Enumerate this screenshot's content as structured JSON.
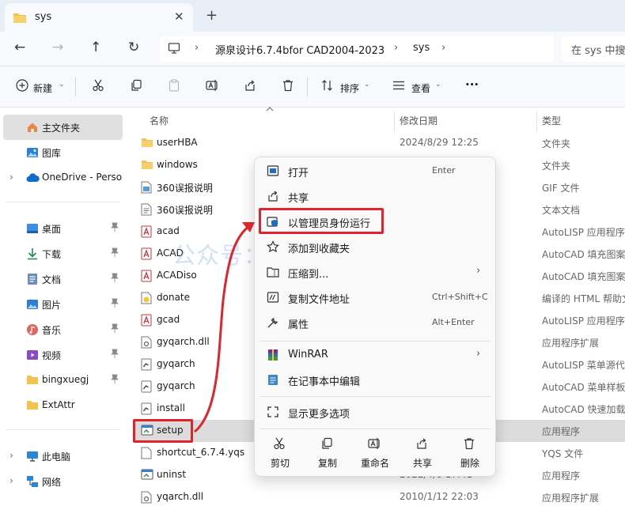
{
  "tab": {
    "title": "sys",
    "close": "✕",
    "new_tab": "+"
  },
  "nav": {
    "back": "←",
    "forward": "→",
    "up": "↑",
    "refresh": "↻"
  },
  "address": {
    "sep": "›",
    "crumbs": [
      "源泉设计6.7.4bfor CAD2004-2023",
      "sys"
    ],
    "search_placeholder": "在 sys 中搜"
  },
  "toolbar": {
    "new_label": "新建",
    "sort_label": "排序",
    "view_label": "查看",
    "more": "···",
    "caret": "⌄"
  },
  "sidebar": {
    "chevron": "›",
    "pin": "📌",
    "top": [
      {
        "label": "主文件夹",
        "icon": "home-icon"
      },
      {
        "label": "图库",
        "icon": "gallery-icon"
      },
      {
        "label": "OneDrive - Perso",
        "icon": "cloud-icon"
      }
    ],
    "quick": [
      {
        "label": "桌面",
        "icon": "desktop-icon"
      },
      {
        "label": "下载",
        "icon": "download-icon"
      },
      {
        "label": "文档",
        "icon": "documents-icon"
      },
      {
        "label": "图片",
        "icon": "pictures-icon"
      },
      {
        "label": "音乐",
        "icon": "music-icon"
      },
      {
        "label": "视频",
        "icon": "video-icon"
      },
      {
        "label": "bingxuegj",
        "icon": "folder-icon"
      },
      {
        "label": "ExtAttr",
        "icon": "folder-icon"
      }
    ],
    "bottom": [
      {
        "label": "此电脑",
        "icon": "pc-icon"
      },
      {
        "label": "网络",
        "icon": "network-icon"
      }
    ]
  },
  "columns": {
    "name": "名称",
    "date": "修改日期",
    "type": "类型"
  },
  "files": [
    {
      "name": "userHBA",
      "date": "2024/8/29 12:25",
      "type": "文件夹",
      "icon": "folder-icon"
    },
    {
      "name": "windows",
      "date": "",
      "type": "文件夹",
      "icon": "folder-icon"
    },
    {
      "name": "360误报说明",
      "date": "",
      "type": "GIF 文件",
      "icon": "image-file-icon"
    },
    {
      "name": "360误报说明",
      "date": "",
      "type": "文本文档",
      "icon": "text-file-icon"
    },
    {
      "name": "acad",
      "date": "",
      "type": "AutoLISP 应用程序源",
      "icon": "autocad-icon"
    },
    {
      "name": "ACAD",
      "date": "",
      "type": "AutoCAD 填充图案",
      "icon": "autocad-icon"
    },
    {
      "name": "ACADiso",
      "date": "",
      "type": "AutoCAD 填充图案",
      "icon": "autocad-icon"
    },
    {
      "name": "donate",
      "date": "",
      "type": "编译的 HTML 帮助文",
      "icon": "help-file-icon"
    },
    {
      "name": "gcad",
      "date": "",
      "type": "AutoLISP 应用程序源",
      "icon": "autocad-icon"
    },
    {
      "name": "gyqarch.dll",
      "date": "",
      "type": "应用程序扩展",
      "icon": "dll-file-icon"
    },
    {
      "name": "gyqarch",
      "date": "",
      "type": "AutoLISP 菜单源代码",
      "icon": "menu-file-icon"
    },
    {
      "name": "gyqarch",
      "date": "",
      "type": "AutoCAD 菜单样板",
      "icon": "menu-file-icon"
    },
    {
      "name": "install",
      "date": "",
      "type": "AutoCAD 快速加载",
      "icon": "menu-file-icon"
    },
    {
      "name": "setup",
      "date": "",
      "type": "应用程序",
      "icon": "exe-icon"
    },
    {
      "name": "shortcut_6.7.4.yqs",
      "date": "",
      "type": "YQS 文件",
      "icon": "blank-file-icon"
    },
    {
      "name": "uninst",
      "date": "2022/4/6 17:41",
      "type": "应用程序",
      "icon": "exe-icon"
    },
    {
      "name": "yqarch.dll",
      "date": "2010/1/12 22:03",
      "type": "应用程序扩展",
      "icon": "dll-file-icon"
    }
  ],
  "watermark": "公众号：冰雪软件库",
  "context_menu": {
    "items": [
      {
        "label": "打开",
        "key": "Enter",
        "icon": "open-icon"
      },
      {
        "label": "共享",
        "key": "",
        "icon": "share-icon"
      },
      {
        "label": "以管理员身份运行",
        "key": "",
        "icon": "admin-shield-icon"
      },
      {
        "label": "添加到收藏夹",
        "key": "",
        "icon": "star-icon"
      },
      {
        "label": "压缩到...",
        "key": "",
        "icon": "zip-icon",
        "sub": "›"
      },
      {
        "label": "复制文件地址",
        "key": "Ctrl+Shift+C",
        "icon": "copy-path-icon"
      },
      {
        "label": "属性",
        "key": "Alt+Enter",
        "icon": "wrench-icon"
      },
      {
        "label": "WinRAR",
        "key": "",
        "icon": "winrar-icon",
        "sub": "›"
      },
      {
        "label": "在记事本中编辑",
        "key": "",
        "icon": "notepad-icon"
      },
      {
        "label": "显示更多选项",
        "key": "",
        "icon": "more-options-icon"
      }
    ],
    "quick_actions": [
      {
        "label": "剪切",
        "icon": "cut-icon"
      },
      {
        "label": "复制",
        "icon": "copy-icon"
      },
      {
        "label": "重命名",
        "icon": "rename-icon"
      },
      {
        "label": "共享",
        "icon": "share-icon"
      },
      {
        "label": "删除",
        "icon": "delete-icon"
      }
    ]
  },
  "colors": {
    "highlight": "#e0242c",
    "selected_row": "#dcdcdc",
    "folder": "#f2c14e",
    "accent": "#0067c0"
  }
}
